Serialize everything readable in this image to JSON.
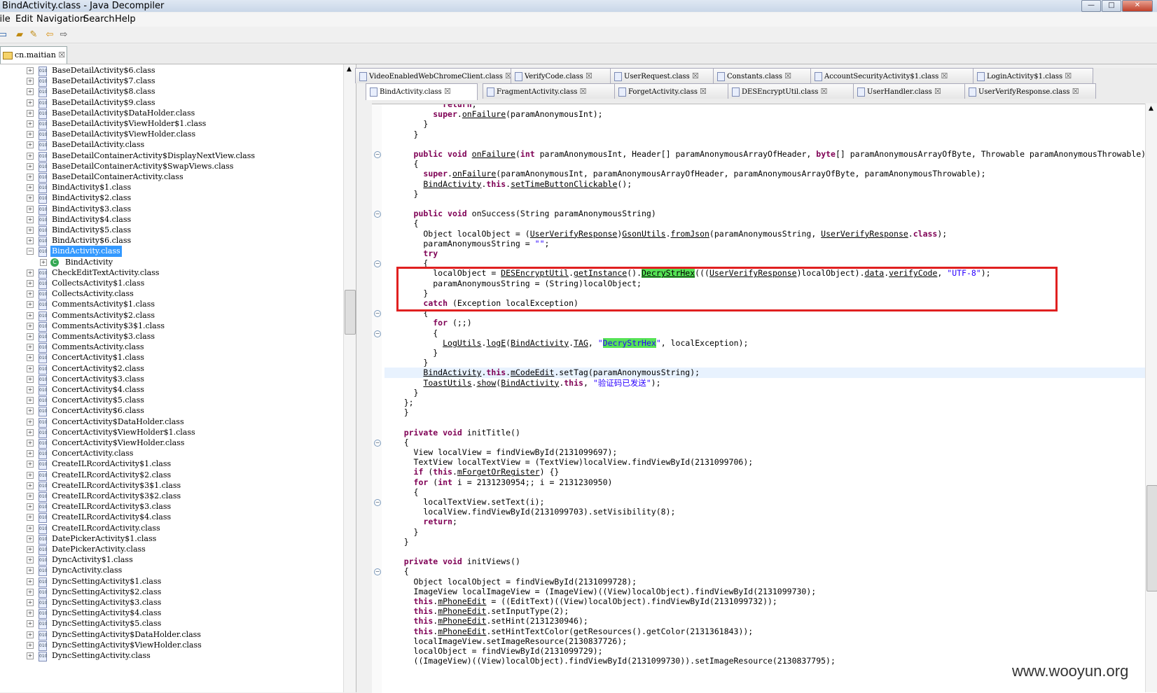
{
  "window": {
    "title": "BindActivity.class - Java Decompiler"
  },
  "window_buttons": [
    "—",
    "□",
    "✕"
  ],
  "menu": [
    "File",
    "Edit",
    "Navigation",
    "Search",
    "Help"
  ],
  "package_tab": {
    "label": "cn.maitian",
    "close": "☒"
  },
  "tree_items": [
    "BaseDetailActivity$6.class",
    "BaseDetailActivity$7.class",
    "BaseDetailActivity$8.class",
    "BaseDetailActivity$9.class",
    "BaseDetailActivity$DataHolder.class",
    "BaseDetailActivity$ViewHolder$1.class",
    "BaseDetailActivity$ViewHolder.class",
    "BaseDetailActivity.class",
    "BaseDetailContainerActivity$DisplayNextView.class",
    "BaseDetailContainerActivity$SwapViews.class",
    "BaseDetailContainerActivity.class",
    "BindActivity$1.class",
    "BindActivity$2.class",
    "BindActivity$3.class",
    "BindActivity$4.class",
    "BindActivity$5.class",
    "BindActivity$6.class",
    "BindActivity.class",
    "BindActivity",
    "CheckEditTextActivity.class",
    "CollectsActivity$1.class",
    "CollectsActivity.class",
    "CommentsActivity$1.class",
    "CommentsActivity$2.class",
    "CommentsActivity$3$1.class",
    "CommentsActivity$3.class",
    "CommentsActivity.class",
    "ConcertActivity$1.class",
    "ConcertActivity$2.class",
    "ConcertActivity$3.class",
    "ConcertActivity$4.class",
    "ConcertActivity$5.class",
    "ConcertActivity$6.class",
    "ConcertActivity$DataHolder.class",
    "ConcertActivity$ViewHolder$1.class",
    "ConcertActivity$ViewHolder.class",
    "ConcertActivity.class",
    "CreateILRcordActivity$1.class",
    "CreateILRcordActivity$2.class",
    "CreateILRcordActivity$3$1.class",
    "CreateILRcordActivity$3$2.class",
    "CreateILRcordActivity$3.class",
    "CreateILRcordActivity$4.class",
    "CreateILRcordActivity.class",
    "DatePickerActivity$1.class",
    "DatePickerActivity.class",
    "DyncActivity$1.class",
    "DyncActivity.class",
    "DyncSettingActivity$1.class",
    "DyncSettingActivity$2.class",
    "DyncSettingActivity$3.class",
    "DyncSettingActivity$4.class",
    "DyncSettingActivity$5.class",
    "DyncSettingActivity$DataHolder.class",
    "DyncSettingActivity$ViewHolder.class",
    "DyncSettingActivity.class"
  ],
  "editor_tabs_row1": [
    "VideoEnabledWebChromeClient.class",
    "VerifyCode.class",
    "UserRequest.class",
    "Constants.class",
    "AccountSecurityActivity$1.class",
    "LoginActivity$1.class"
  ],
  "editor_tabs_row2": [
    "BindActivity.class",
    "FragmentActivity.class",
    "ForgetActivity.class",
    "DESEncryptUtil.class",
    "UserHandler.class",
    "UserVerifyResponse.class"
  ],
  "tab_close": "☒",
  "code_lines": [
    "        return;",
    "      super.onFailure(paramAnonymousInt);",
    "    }",
    "  }",
    "",
    "  public void onFailure(int paramAnonymousInt, Header[] paramAnonymousArrayOfHeader, byte[] paramAnonymousArrayOfByte, Throwable paramAnonymousThrowable)",
    "  {",
    "    super.onFailure(paramAnonymousInt, paramAnonymousArrayOfHeader, paramAnonymousArrayOfByte, paramAnonymousThrowable);",
    "    BindActivity.this.setTimeButtonClickable();",
    "  }",
    "",
    "  public void onSuccess(String paramAnonymousString)",
    "  {",
    "    Object localObject = (UserVerifyResponse)GsonUtils.fromJson(paramAnonymousString, UserVerifyResponse.class);",
    "    paramAnonymousString = \"\";",
    "    try",
    "    {",
    "      localObject = DESEncryptUtil.getInstance().DecryStrHex(((UserVerifyResponse)localObject).data.verifyCode, \"UTF-8\");",
    "      paramAnonymousString = (String)localObject;",
    "    }",
    "    catch (Exception localException)",
    "    {",
    "      for (;;)",
    "      {",
    "        LogUtils.logE(BindActivity.TAG, \"DecryStrHex\", localException);",
    "      }",
    "    }",
    "    BindActivity.this.mCodeEdit.setTag(paramAnonymousString);",
    "    ToastUtils.show(BindActivity.this, \"验证码已发送\");",
    "  }",
    "};",
    "}",
    "",
    "private void initTitle()",
    "{",
    "  View localView = findViewById(2131099697);",
    "  TextView localTextView = (TextView)localView.findViewById(2131099706);",
    "  if (this.mForgetOrRegister) {}",
    "  for (int i = 2131230954;; i = 2131230950)",
    "  {",
    "    localTextView.setText(i);",
    "    localView.findViewById(2131099703).setVisibility(8);",
    "    return;",
    "  }",
    "}",
    "",
    "private void initViews()",
    "{",
    "  Object localObject = findViewById(2131099728);",
    "  ImageView localImageView = (ImageView)((View)localObject).findViewById(2131099730);",
    "  this.mPhoneEdit = ((EditText)((View)localObject).findViewById(2131099732));",
    "  this.mPhoneEdit.setInputType(2);",
    "  this.mPhoneEdit.setHint(2131230946);",
    "  this.mPhoneEdit.setHintTextColor(getResources().getColor(2131361843));",
    "  localImageView.setImageResource(2130837726);",
    "  localObject = findViewById(2131099729);",
    "  ((ImageView)((View)localObject).findViewById(2131099730)).setImageResource(2130837795);"
  ],
  "watermark": "www.wooyun.org"
}
